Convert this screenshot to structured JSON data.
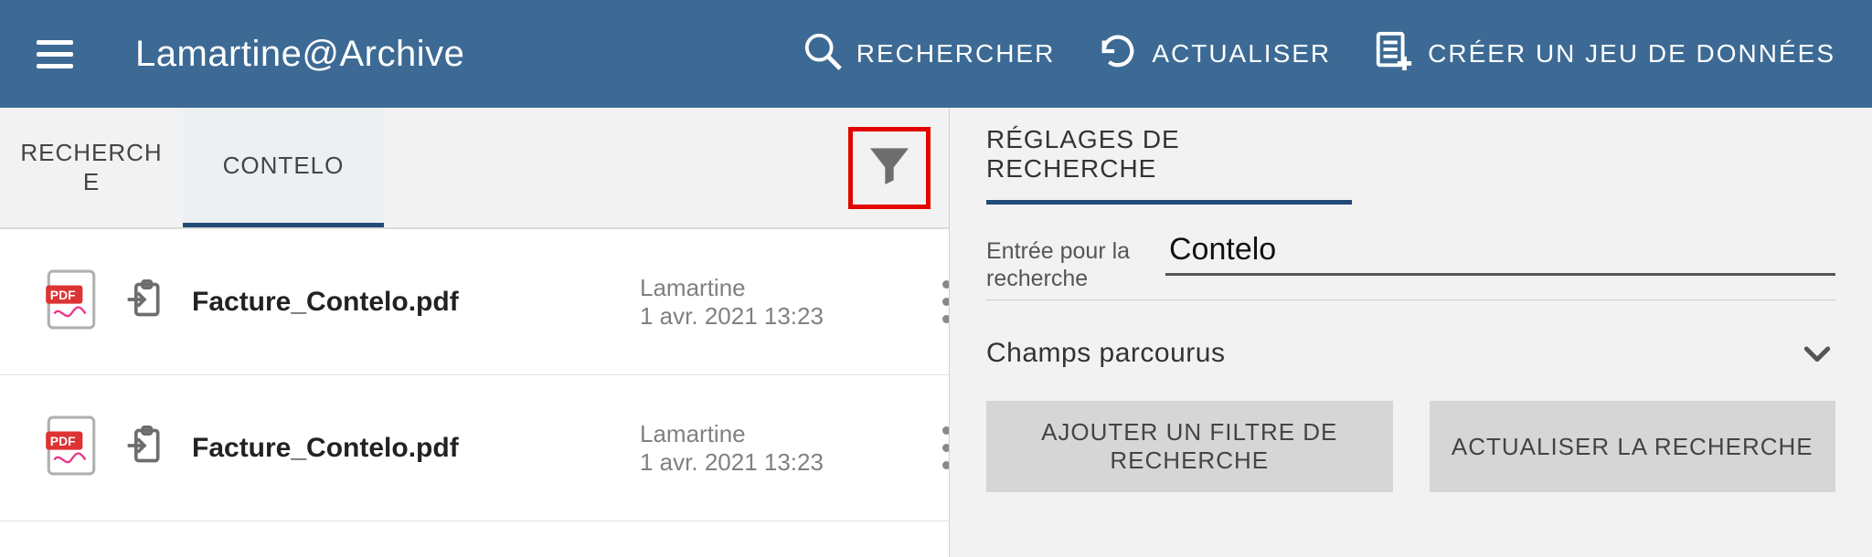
{
  "header": {
    "app_title": "Lamartine@Archive",
    "actions": {
      "search": "RECHERCHER",
      "refresh": "ACTUALISER",
      "create": "CRÉER UN JEU DE DONNÉES"
    }
  },
  "tabs": {
    "recherche": "RECHERCHE",
    "contelo": "CONTELO"
  },
  "results": [
    {
      "filename": "Facture_Contelo.pdf",
      "author": "Lamartine",
      "date": "1 avr. 2021 13:23"
    },
    {
      "filename": "Facture_Contelo.pdf",
      "author": "Lamartine",
      "date": "1 avr. 2021 13:23"
    }
  ],
  "side_panel": {
    "title": "RÉGLAGES DE RECHERCHE",
    "entry_label": "Entrée pour la recherche",
    "entry_value": "Contelo",
    "champs_label": "Champs parcourus",
    "btn_add_filter": "AJOUTER UN FILTRE DE RECHERCHE",
    "btn_refresh_search": "ACTUALISER LA RECHERCHE"
  }
}
